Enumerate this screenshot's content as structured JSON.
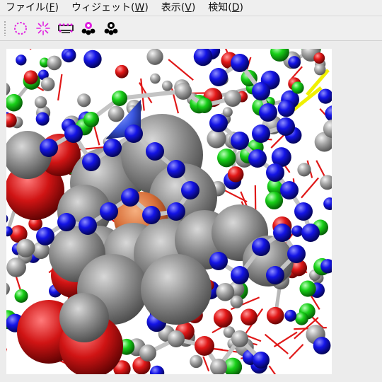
{
  "menubar": {
    "items": [
      {
        "label": "ファイル(",
        "mnemonic": "F",
        "suffix": ")"
      },
      {
        "label": "ウィジェット(",
        "mnemonic": "W",
        "suffix": ")"
      },
      {
        "label": "表示(",
        "mnemonic": "V",
        "suffix": ")"
      },
      {
        "label": "検知(",
        "mnemonic": "D",
        "suffix": ")"
      }
    ]
  },
  "toolbar": {
    "buttons": [
      {
        "icon": "dotted-ring-icon",
        "color": "#e020e0"
      },
      {
        "icon": "starburst-icon",
        "color": "#e020e0"
      },
      {
        "icon": "pocket-bridge-icon",
        "color": "#e020e0"
      },
      {
        "icon": "cluster-pink-icon",
        "color": "#e020e0"
      },
      {
        "icon": "cluster-black-icon",
        "color": "#000000"
      }
    ]
  },
  "viewer": {
    "colors": {
      "carbon": "#9a9a9a",
      "nitrogen": "#1515e0",
      "oxygen": "#e01818",
      "chlorine": "#18d018",
      "sulfur": "#f0f000",
      "metal": "#e07a3a",
      "ligand_nitrogen": "#3a5ae8"
    }
  }
}
